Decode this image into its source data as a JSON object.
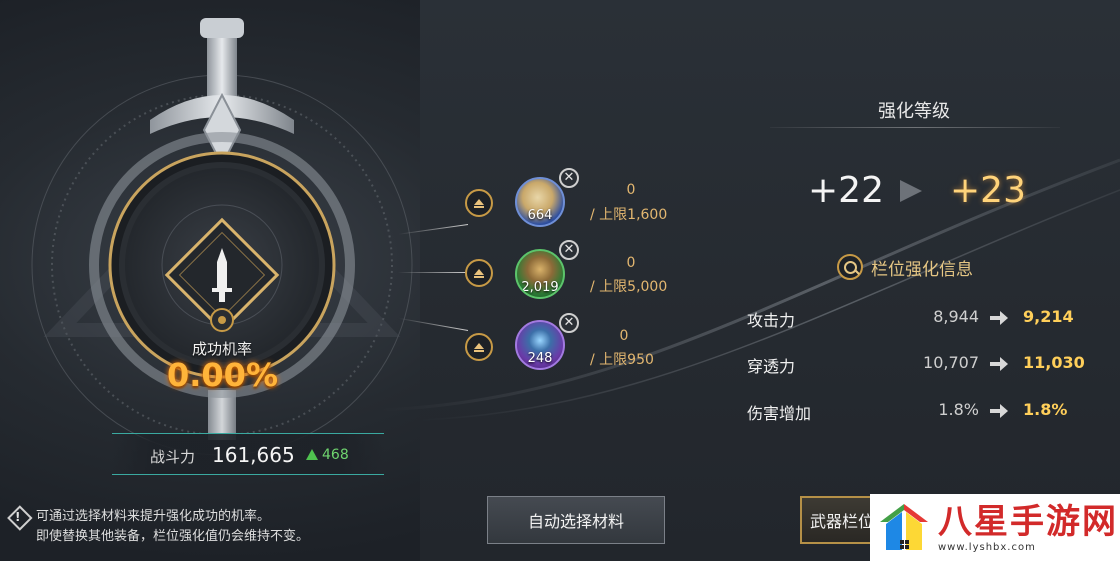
{
  "enhance": {
    "success_label": "成功机率",
    "success_rate": "0.00%"
  },
  "combat_power": {
    "label": "战斗力",
    "value": "161,665",
    "increase": "468"
  },
  "materials": [
    {
      "count": "664",
      "owned": "0",
      "limit": "/ 上限1,600",
      "icon": "scroll-icon"
    },
    {
      "count": "2,019",
      "owned": "0",
      "limit": "/ 上限5,000",
      "icon": "pyramid-icon"
    },
    {
      "count": "248",
      "owned": "0",
      "limit": "/ 上限950",
      "icon": "crystal-icon"
    }
  ],
  "level_panel": {
    "title": "强化等级",
    "current": "+22",
    "next": "+23",
    "info_link": "栏位强化信息"
  },
  "stats": [
    {
      "name": "攻击力",
      "current": "8,944",
      "next": "9,214"
    },
    {
      "name": "穿透力",
      "current": "10,707",
      "next": "11,030"
    },
    {
      "name": "伤害增加",
      "current": "1.8%",
      "next": "1.8%"
    }
  ],
  "notice": {
    "line1": "可通过选择材料来提升强化成功的机率。",
    "line2": "即使替换其他装备，栏位强化值仍会维持不变。"
  },
  "buttons": {
    "auto_select": "自动选择材料",
    "weapon_slot": "武器栏位"
  },
  "watermark": {
    "title": "八星手游网",
    "url": "www.lyshbx.com"
  },
  "colors": {
    "accent_gold": "#e9c27c",
    "rate_orange": "#ffb43a",
    "increase_green": "#4fc24f",
    "new_value_yellow": "#ffcf5a"
  }
}
